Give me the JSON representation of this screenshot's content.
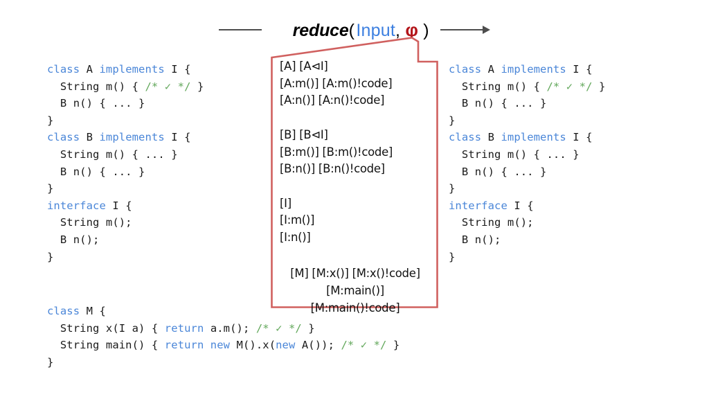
{
  "header": {
    "prefix_symbol": "line-segment",
    "function_name": "reduce",
    "open_paren": "(",
    "arg_input": "Input",
    "separator": ",",
    "arg_phi": "φ",
    "close_paren": ")",
    "suffix_symbol": "right-arrow",
    "colors": {
      "input": "#3c7fe0",
      "phi": "#b3151a",
      "arrow": "#4d4d4d"
    }
  },
  "colors": {
    "keyword_blue": "#4a86d8",
    "comment_green": "#63a85c",
    "callout_border_red": "#d0605f",
    "text_black": "#1a1a1a",
    "background": "#ffffff"
  },
  "code_left": {
    "language": "java",
    "lines": [
      [
        {
          "t": "class ",
          "c": "kw"
        },
        {
          "t": "A ",
          "c": ""
        },
        {
          "t": "implements ",
          "c": "kw"
        },
        {
          "t": "I {",
          "c": ""
        }
      ],
      [
        {
          "t": "  String m() { ",
          "c": ""
        },
        {
          "t": "/* ✓ */",
          "c": "cm"
        },
        {
          "t": " }",
          "c": ""
        }
      ],
      [
        {
          "t": "  B n() { ... }",
          "c": ""
        }
      ],
      [
        {
          "t": "}",
          "c": ""
        }
      ],
      [
        {
          "t": "class ",
          "c": "kw"
        },
        {
          "t": "B ",
          "c": ""
        },
        {
          "t": "implements ",
          "c": "kw"
        },
        {
          "t": "I {",
          "c": ""
        }
      ],
      [
        {
          "t": "  String m() { ... }",
          "c": ""
        }
      ],
      [
        {
          "t": "  B n() { ... }",
          "c": ""
        }
      ],
      [
        {
          "t": "}",
          "c": ""
        }
      ],
      [
        {
          "t": "interface ",
          "c": "kw"
        },
        {
          "t": "I {",
          "c": ""
        }
      ],
      [
        {
          "t": "  String m();",
          "c": ""
        }
      ],
      [
        {
          "t": "  B n();",
          "c": ""
        }
      ],
      [
        {
          "t": "}",
          "c": ""
        }
      ]
    ]
  },
  "code_right": {
    "language": "java",
    "lines": [
      [
        {
          "t": "class ",
          "c": "kw"
        },
        {
          "t": "A ",
          "c": ""
        },
        {
          "t": "implements ",
          "c": "kw"
        },
        {
          "t": "I {",
          "c": ""
        }
      ],
      [
        {
          "t": "  String m() { ",
          "c": ""
        },
        {
          "t": "/* ✓ */",
          "c": "cm"
        },
        {
          "t": " }",
          "c": ""
        }
      ],
      [
        {
          "t": "  B n() { ... }",
          "c": ""
        }
      ],
      [
        {
          "t": "}",
          "c": ""
        }
      ],
      [
        {
          "t": "class ",
          "c": "kw"
        },
        {
          "t": "B ",
          "c": ""
        },
        {
          "t": "implements ",
          "c": "kw"
        },
        {
          "t": "I {",
          "c": ""
        }
      ],
      [
        {
          "t": "  String m() { ... }",
          "c": ""
        }
      ],
      [
        {
          "t": "  B n() { ... }",
          "c": ""
        }
      ],
      [
        {
          "t": "}",
          "c": ""
        }
      ],
      [
        {
          "t": "interface ",
          "c": "kw"
        },
        {
          "t": "I {",
          "c": ""
        }
      ],
      [
        {
          "t": "  String m();",
          "c": ""
        }
      ],
      [
        {
          "t": "  B n();",
          "c": ""
        }
      ],
      [
        {
          "t": "}",
          "c": ""
        }
      ]
    ]
  },
  "code_bottom": {
    "language": "java",
    "lines": [
      [
        {
          "t": "class ",
          "c": "kw"
        },
        {
          "t": "M {",
          "c": ""
        }
      ],
      [
        {
          "t": "  String x(I a) { ",
          "c": ""
        },
        {
          "t": "return ",
          "c": "kw"
        },
        {
          "t": "a.m(); ",
          "c": ""
        },
        {
          "t": "/* ✓ */",
          "c": "cm"
        },
        {
          "t": " }",
          "c": ""
        }
      ],
      [
        {
          "t": "  String main() { ",
          "c": ""
        },
        {
          "t": "return new ",
          "c": "kw"
        },
        {
          "t": "M().x(",
          "c": ""
        },
        {
          "t": "new ",
          "c": "kw"
        },
        {
          "t": "A()); ",
          "c": ""
        },
        {
          "t": "/* ✓ */",
          "c": "cm"
        },
        {
          "t": " }",
          "c": ""
        }
      ],
      [
        {
          "t": "}",
          "c": ""
        }
      ]
    ]
  },
  "callout": {
    "border_color": "#d0605f",
    "fill_color": "#ffffff",
    "pointer": "top-right-notch",
    "lines": [
      {
        "text": "[A] [A⊲I]",
        "align": "left"
      },
      {
        "text": "[A:m()] [A:m()!code]",
        "align": "left"
      },
      {
        "text": "[A:n()] [A:n()!code]",
        "align": "left"
      },
      {
        "text": "",
        "align": "left"
      },
      {
        "text": "[B] [B⊲I]",
        "align": "left"
      },
      {
        "text": "[B:m()] [B:m()!code]",
        "align": "left"
      },
      {
        "text": "[B:n()] [B:n()!code]",
        "align": "left"
      },
      {
        "text": "",
        "align": "left"
      },
      {
        "text": "[I]",
        "align": "left"
      },
      {
        "text": "[I:m()]",
        "align": "left"
      },
      {
        "text": "[I:n()]",
        "align": "left"
      },
      {
        "text": "",
        "align": "left"
      },
      {
        "text": "[M] [M:x()] [M:x()!code]",
        "align": "center"
      },
      {
        "text": "[M:main()]",
        "align": "center"
      },
      {
        "text": "[M:main()!code]",
        "align": "center"
      }
    ]
  }
}
